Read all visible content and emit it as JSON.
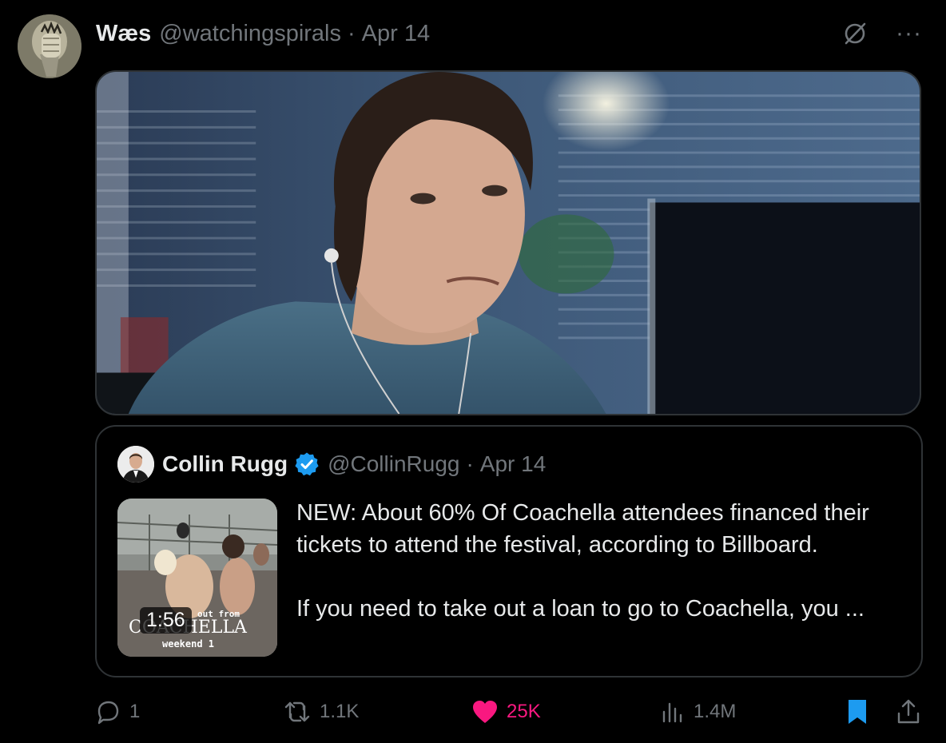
{
  "author": {
    "name": "Wæs",
    "handle": "@watchingspirals",
    "separator": "·",
    "date": "Apr 14"
  },
  "header_icons": [
    "grok-icon",
    "more-icon"
  ],
  "more_label": "···",
  "media": {
    "type": "image"
  },
  "quoted_tweet": {
    "name": "Collin Rugg",
    "verified": true,
    "handle": "@CollinRugg",
    "separator": "·",
    "date": "Apr 14",
    "video_duration": "1:56",
    "text_paragraphs": [
      "NEW: About 60% Of Coachella attendees financed their tickets to attend the festival, according to Billboard.",
      "If you need to take out a loan to go to Coachella, you ..."
    ],
    "thumbnail_text": [
      "out from",
      "COACHELLA",
      "weekend 1"
    ]
  },
  "actions": {
    "replies": "1",
    "reposts": "1.1K",
    "likes": "25K",
    "views": "1.4M",
    "liked": true,
    "bookmarked": true
  },
  "colors": {
    "background": "#000000",
    "text": "#e7e9ea",
    "secondary": "#71767b",
    "like": "#f91880",
    "accent": "#1d9bf0",
    "border": "#2f3336"
  }
}
